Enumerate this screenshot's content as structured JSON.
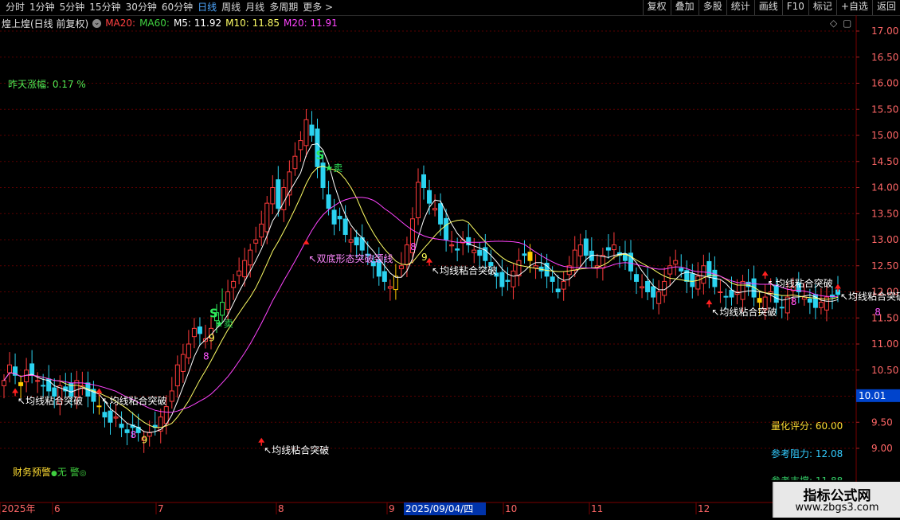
{
  "toolbar": {
    "periods": [
      "分时",
      "1分钟",
      "5分钟",
      "15分钟",
      "30分钟",
      "60分钟",
      "日线",
      "周线",
      "月线",
      "多周期",
      "更多 >"
    ],
    "active_period": "日线",
    "tools": [
      "复权",
      "叠加",
      "多股",
      "统计",
      "画线",
      "F10",
      "标记",
      "+自选",
      "返回"
    ]
  },
  "info": {
    "title": "煌上煌(日线 前复权)",
    "ma20_label": "MA20:",
    "ma60_label": "MA60:",
    "m5": "M5: 11.92",
    "m10": "M10: 11.85",
    "m20": "M20: 11.91",
    "colors": {
      "ma20": "#ff4040",
      "ma60": "#40d040",
      "m5": "#ffffff",
      "m10": "#ffff66",
      "m20": "#ff44ff"
    }
  },
  "left_panel": {
    "yesterday_change": "昨天涨幅: 0.17 %",
    "finance_warning_label": "财务预警",
    "finance_warning_value": "无 警"
  },
  "right_panel": {
    "quant_score": "量化评分: 60.00",
    "ref_resistance": "参考阻力: 12.08",
    "ref_support_partial": "参考支撑: 11.88"
  },
  "price_axis": {
    "ticks": [
      "17.00",
      "16.50",
      "16.00",
      "15.50",
      "15.00",
      "14.50",
      "14.00",
      "13.50",
      "13.00",
      "12.50",
      "12.00",
      "11.50",
      "11.00",
      "10.50",
      "10.00",
      "9.50",
      "9.00"
    ],
    "current": "10.01"
  },
  "time_axis": {
    "labels": [
      "2025年",
      "6",
      "7",
      "8",
      "9",
      "2025/09/04/四",
      "10",
      "11",
      "12"
    ]
  },
  "annotations": {
    "ma_breakout": "均线粘合突破",
    "double_bottom": "双底形态突破颈线",
    "sell_s": "S",
    "sell_text": "卖",
    "num8": "8",
    "num9": "9"
  },
  "watermark": {
    "line1": "指标公式网",
    "line2": "www.zbgs3.com"
  }
}
